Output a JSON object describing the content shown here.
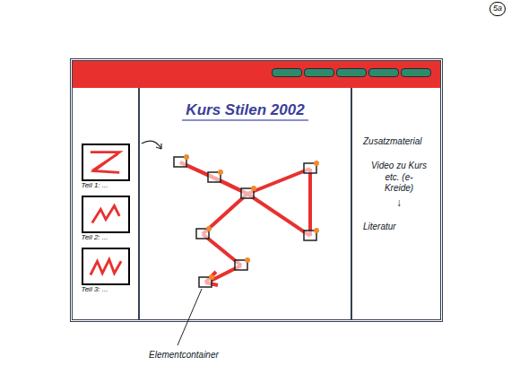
{
  "page_number": "5a",
  "title": "Kurs Stilen 2002",
  "parts": [
    {
      "label": "Teil 1: ..."
    },
    {
      "label": "Teil 2: ..."
    },
    {
      "label": "Teil 3: ..."
    }
  ],
  "extras": {
    "heading": "Zusatzmaterial",
    "video_lines": [
      "Video zu Kurs",
      "etc. (e-",
      "Kreide)"
    ],
    "arrow": "↓",
    "literature": "Literatur"
  },
  "annotation": "Elementcontainer"
}
